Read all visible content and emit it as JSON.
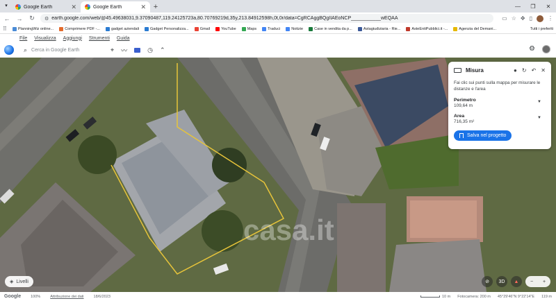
{
  "browser": {
    "tabs": [
      {
        "title": "Google Earth",
        "active": false
      },
      {
        "title": "Google Earth",
        "active": true
      }
    ],
    "url": "earth.google.com/web/@45.49638031,9.37090487,119.24125723a,80.70769219d,35y,213.84912598h,0t,0r/data=CgRCAggBQgIIAEoNCP___________wEQAA",
    "bookmarks": [
      {
        "label": "PlanningWiz online...",
        "color": "#4a8bd6"
      },
      {
        "label": "Comprimere PDF -...",
        "color": "#e36b2c"
      },
      {
        "label": "gadget aziendali",
        "color": "#2a7bd2"
      },
      {
        "label": "Gadget Personalizza...",
        "color": "#2a7bd2"
      },
      {
        "label": "Gmail",
        "color": "#ea4335"
      },
      {
        "label": "YouTube",
        "color": "#ff0000"
      },
      {
        "label": "Maps",
        "color": "#34a853"
      },
      {
        "label": "Traduci",
        "color": "#4285f4"
      },
      {
        "label": "Notizie",
        "color": "#4285f4"
      },
      {
        "label": "Case in vendita da p...",
        "color": "#1a7a3c"
      },
      {
        "label": "Astagiudiziaria - Rie...",
        "color": "#3b5998"
      },
      {
        "label": "AsteEntiPubblici.it -...",
        "color": "#c0392b"
      },
      {
        "label": "Agenzia del Demani...",
        "color": "#e6b800"
      }
    ],
    "bookmarks_all": "Tutti i preferiti"
  },
  "menu": {
    "file": "File",
    "view": "Visualizza",
    "add": "Aggiungi",
    "tools": "Strumenti",
    "help": "Guida"
  },
  "earth": {
    "search_placeholder": "Cerca in Google Earth"
  },
  "measure_panel": {
    "title": "Misura",
    "hint": "Fai clic sui punti sulla mappa per misurare le distanze e l'area",
    "perimeter_label": "Perimetro",
    "perimeter_value": "109,64 m",
    "area_label": "Area",
    "area_value": "716,35 m²",
    "save_label": "Salva nel progetto"
  },
  "map": {
    "layers_label": "Livelli",
    "view_3d": "3D",
    "watermark": "casa.it"
  },
  "status": {
    "brand": "Google",
    "zoom": "100%",
    "attribution": "Attribuzione dei dati",
    "date": "18/6/2023",
    "scale": "10 m",
    "camera": "Fotocamera: 200 m",
    "coords": "45°29'46\"N 9°22'14\"E",
    "elevation": "119 m"
  }
}
